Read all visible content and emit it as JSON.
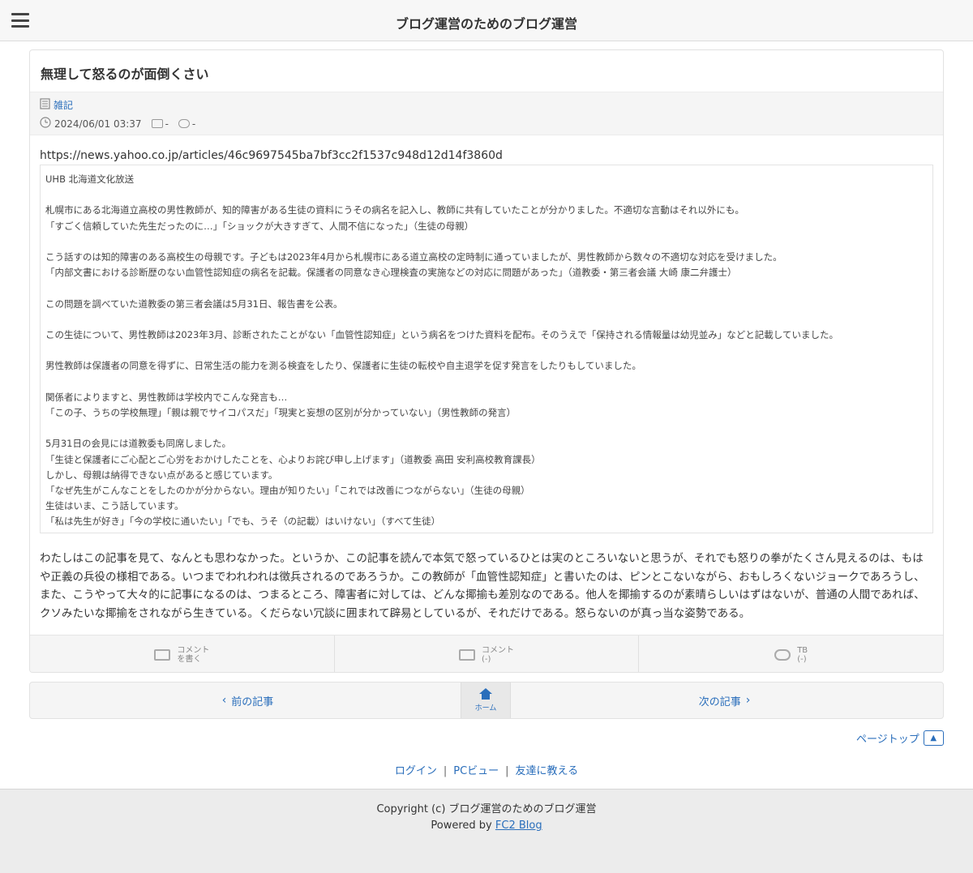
{
  "header": {
    "site_title": "ブログ運営のためのブログ運営"
  },
  "article": {
    "title": "無理して怒るのが面倒くさい",
    "category": "雑記",
    "datetime": "2024/06/01 03:37",
    "comment_count": "-",
    "trackback_count": "-",
    "url": "https://news.yahoo.co.jp/articles/46c9697545ba7bf3cc2f1537c948d12d14f3860d",
    "quote": "UHB 北海道文化放送\n\n札幌市にある北海道立高校の男性教師が、知的障害がある生徒の資料にうその病名を記入し、教師に共有していたことが分かりました。不適切な言動はそれ以外にも。\n「すごく信頼していた先生だったのに…」「ショックが大きすぎて、人間不信になった」（生徒の母親）\n\nこう話すのは知的障害のある高校生の母親です。子どもは2023年4月から札幌市にある道立高校の定時制に通っていましたが、男性教師から数々の不適切な対応を受けました。\n「内部文書における診断歴のない血管性認知症の病名を記載。保護者の同意なき心理検査の実施などの対応に問題があった」（道教委・第三者会議 大崎 康二弁護士）\n\nこの問題を調べていた道教委の第三者会議は5月31日、報告書を公表。\n\nこの生徒について、男性教師は2023年3月、診断されたことがない「血管性認知症」という病名をつけた資料を配布。そのうえで「保持される情報量は幼児並み」などと記載していました。\n\n男性教師は保護者の同意を得ずに、日常生活の能力を測る検査をしたり、保護者に生徒の転校や自主退学を促す発言をしたりもしていました。\n\n関係者によりますと、男性教師は学校内でこんな発言も…\n「この子、うちの学校無理」「親は親でサイコパスだ」「現実と妄想の区別が分かっていない」（男性教師の発言）\n\n5月31日の会見には道教委も同席しました。\n「生徒と保護者にご心配とご心労をおかけしたことを、心よりお詫び申し上げます」（道教委 高田 安利高校教育課長）\nしかし、母親は納得できない点があると感じています。\n「なぜ先生がこんなことをしたのかが分からない。理由が知りたい」「これでは改善につながらない」（生徒の母親）\n生徒はいま、こう話しています。\n「私は先生が好き」「今の学校に通いたい」「でも、うそ（の記載）はいけない」（すべて生徒）",
    "body": "わたしはこの記事を見て、なんとも思わなかった。というか、この記事を読んで本気で怒っているひとは実のところいないと思うが、それでも怒りの拳がたくさん見えるのは、もはや正義の兵役の様相である。いつまでわれわれは徴兵されるのであろうか。この教師が「血管性認知症」と書いたのは、ピンとこないながら、おもしろくないジョークであろうし、また、こうやって大々的に記事になるのは、つまるところ、障害者に対しては、どんな揶揄も差別なのである。他人を揶揄するのが素晴らしいはずはないが、普通の人間であれば、クソみたいな揶揄をされながら生きている。くだらない冗談に囲まれて辟易としているが、それだけである。怒らないのが真っ当な姿勢である。"
  },
  "actions": {
    "write_comment_line1": "コメント",
    "write_comment_line2": "を書く",
    "comment_line1": "コメント",
    "comment_line2": "(-)",
    "tb_line1": "TB",
    "tb_line2": "(-)"
  },
  "nav": {
    "prev_label": "前の記事",
    "home_label": "ホーム",
    "next_label": "次の記事"
  },
  "pagetop": {
    "label": "ページトップ"
  },
  "footer_links": {
    "login": "ログイン",
    "pc_view": "PCビュー",
    "tell_friend": "友達に教える"
  },
  "footer": {
    "copyright": "Copyright (c) ブログ運営のためのブログ運営",
    "powered_prefix": "Powered by",
    "powered_link": "FC2 Blog"
  },
  "colors": {
    "link": "#2a6ebb",
    "header_bg": "#f7f7f7",
    "footer_bg": "#ececec"
  },
  "icons": [
    "menu-icon",
    "category-icon",
    "clock-icon",
    "comment-icon",
    "trackback-icon",
    "write-comment-icon",
    "home-icon",
    "chevron-left-icon",
    "chevron-right-icon",
    "chevron-up-icon"
  ]
}
